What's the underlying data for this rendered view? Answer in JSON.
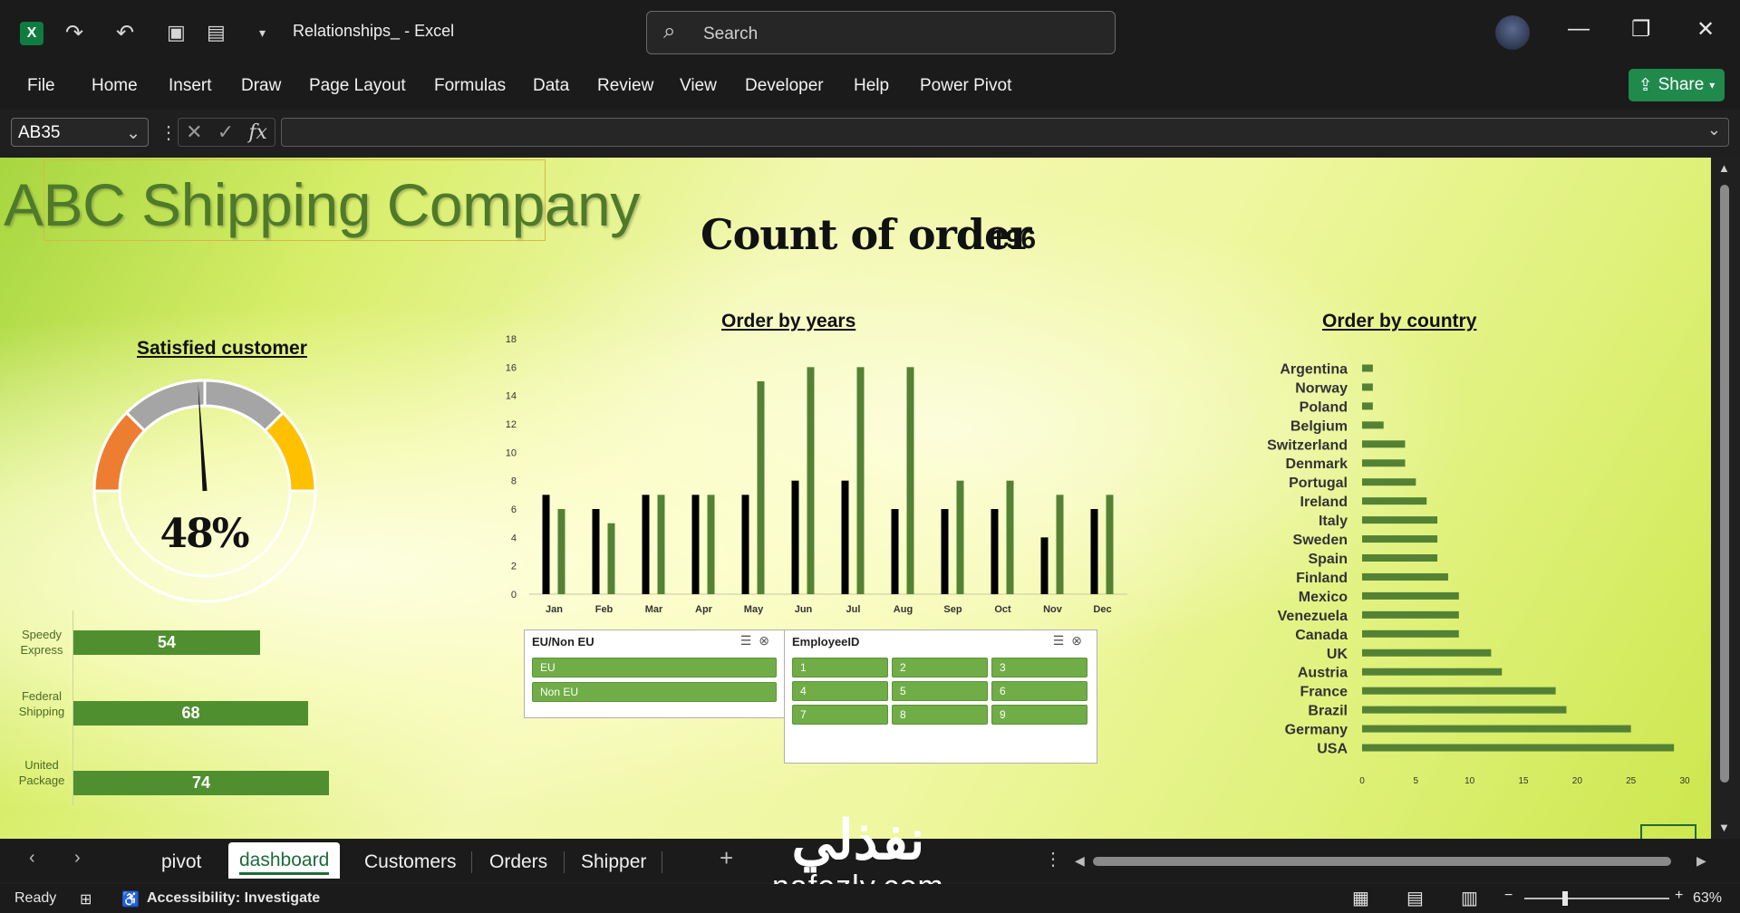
{
  "app": {
    "title": "Relationships_  -  Excel",
    "search_placeholder": "Search",
    "share_label": "Share"
  },
  "ribbon": {
    "tabs": [
      "File",
      "Home",
      "Insert",
      "Draw",
      "Page Layout",
      "Formulas",
      "Data",
      "Review",
      "View",
      "Developer",
      "Help",
      "Power Pivot"
    ]
  },
  "formula_bar": {
    "name_box": "AB35",
    "formula": ""
  },
  "dashboard": {
    "company": "ABC Shipping Company",
    "count_label": "Count of order",
    "count_value": "196",
    "satisfied_title": "Satisfied customer",
    "satisfied_pct": "48%",
    "satisfied_value": 0.48,
    "years_title": "Order by years",
    "country_title": "Order by country",
    "shippers": [
      {
        "label": "Speedy Express",
        "value": "54"
      },
      {
        "label": "Federal Shipping",
        "value": "68"
      },
      {
        "label": "United Package",
        "value": "74"
      }
    ],
    "colors": {
      "bar_green": "#548235",
      "bar_black": "#000000",
      "accent_orange": "#ed7d31",
      "accent_yellow": "#ffc000",
      "accent_gray": "#a5a5a5"
    }
  },
  "chart_data": [
    {
      "type": "bar",
      "title": "Order by years",
      "categories": [
        "Jan",
        "Feb",
        "Mar",
        "Apr",
        "May",
        "Jun",
        "Jul",
        "Aug",
        "Sep",
        "Oct",
        "Nov",
        "Dec"
      ],
      "series": [
        {
          "values": [
            7,
            6,
            7,
            7,
            7,
            8,
            8,
            6,
            6,
            6,
            4,
            6
          ]
        },
        {
          "values": [
            6,
            5,
            7,
            7,
            15,
            16,
            16,
            16,
            8,
            8,
            7,
            7
          ]
        }
      ],
      "ylim": [
        0,
        18
      ],
      "yticks": [
        0,
        2,
        4,
        6,
        8,
        10,
        12,
        14,
        16,
        18
      ]
    },
    {
      "type": "bar",
      "title": "Order by country",
      "orientation": "horizontal",
      "categories": [
        "Argentina",
        "Norway",
        "Poland",
        "Belgium",
        "Switzerland",
        "Denmark",
        "Portugal",
        "Ireland",
        "Italy",
        "Sweden",
        "Spain",
        "Finland",
        "Mexico",
        "Venezuela",
        "Canada",
        "UK",
        "Austria",
        "France",
        "Brazil",
        "Germany",
        "USA"
      ],
      "values": [
        1,
        1,
        1,
        2,
        4,
        4,
        5,
        6,
        7,
        7,
        7,
        8,
        9,
        9,
        9,
        12,
        13,
        18,
        19,
        25,
        29
      ],
      "xlim": [
        0,
        30
      ],
      "xticks": [
        0,
        5,
        10,
        15,
        20,
        25,
        30
      ]
    }
  ],
  "slicers": {
    "region": {
      "title": "EU/Non EU",
      "items": [
        "EU",
        "Non EU"
      ]
    },
    "employee": {
      "title": "EmployeeID",
      "items": [
        "1",
        "2",
        "3",
        "4",
        "5",
        "6",
        "7",
        "8",
        "9"
      ]
    }
  },
  "sheet_tabs": [
    "pivot",
    "dashboard",
    "Customers",
    "Orders",
    "Shipper"
  ],
  "watermark": {
    "arabic": "نفذلي",
    "latin": "nafezly.com"
  },
  "status": {
    "ready": "Ready",
    "accessibility": "Accessibility: Investigate",
    "zoom": "63%"
  }
}
